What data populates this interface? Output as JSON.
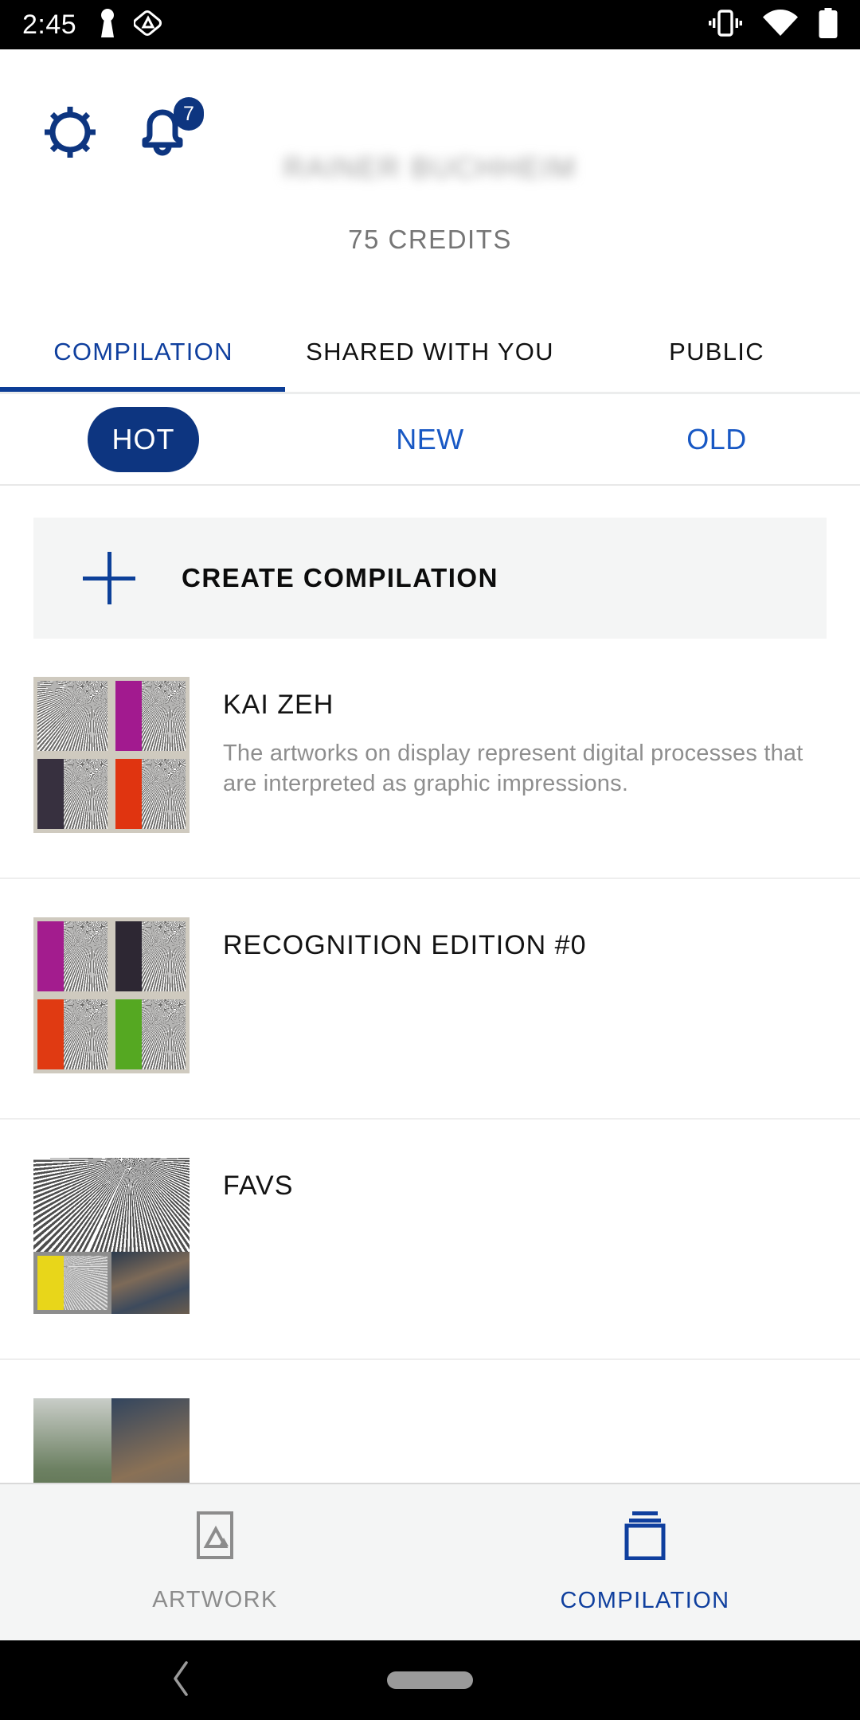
{
  "status_bar": {
    "time": "2:45",
    "left_icons": [
      "keyhole-icon",
      "triangle-badge-icon"
    ],
    "right_icons": [
      "vibrate-icon",
      "wifi-icon",
      "battery-icon"
    ]
  },
  "header": {
    "settings_icon": "gear-icon",
    "notifications_icon": "bell-icon",
    "notification_count": "7",
    "user_name": "RAINER BUCHHEIM",
    "credits": "75 CREDITS"
  },
  "tabs": [
    {
      "label": "COMPILATION",
      "active": true
    },
    {
      "label": "SHARED WITH YOU",
      "active": false
    },
    {
      "label": "PUBLIC",
      "active": false
    }
  ],
  "filters": [
    {
      "label": "HOT",
      "active": true
    },
    {
      "label": "NEW",
      "active": false
    },
    {
      "label": "OLD",
      "active": false
    }
  ],
  "create_row": {
    "icon": "plus-icon",
    "label": "CREATE COMPILATION"
  },
  "list": [
    {
      "title": "KAI ZEH",
      "description": "The artworks on display represent digital processes that are interpreted as graphic impressions.",
      "thumb_type": "quad",
      "thumb_colors": [
        "#bdbdbd",
        "#a21a8f",
        "#37303f",
        "#e03410"
      ]
    },
    {
      "title": "RECOGNITION EDITION #0",
      "description": "",
      "thumb_type": "quad",
      "thumb_colors": [
        "#a31c8e",
        "#2d2733",
        "#e03a12",
        "#55a822"
      ]
    },
    {
      "title": "FAVS",
      "description": "",
      "thumb_type": "favs",
      "thumb_colors": [
        "#b3b3b3",
        "#e8d61a",
        "#6b6a70"
      ]
    },
    {
      "title": "",
      "description": "",
      "thumb_type": "photos",
      "thumb_colors": [
        "#8b9d82",
        "#5d6a7c"
      ]
    }
  ],
  "bottom_nav": [
    {
      "label": "ARTWORK",
      "icon": "framed-picture-icon",
      "active": false
    },
    {
      "label": "COMPILATION",
      "icon": "stacked-layers-icon",
      "active": true
    }
  ],
  "nav_bar": {
    "back_icon": "back-chevron-icon",
    "home_icon": "home-pill-icon"
  },
  "colors": {
    "accent_blue": "#0d3580",
    "link_blue": "#1858c4",
    "tab_blue": "#0f3f9e",
    "muted_grey": "#8e8e8e",
    "panel_grey": "#f4f5f5"
  }
}
